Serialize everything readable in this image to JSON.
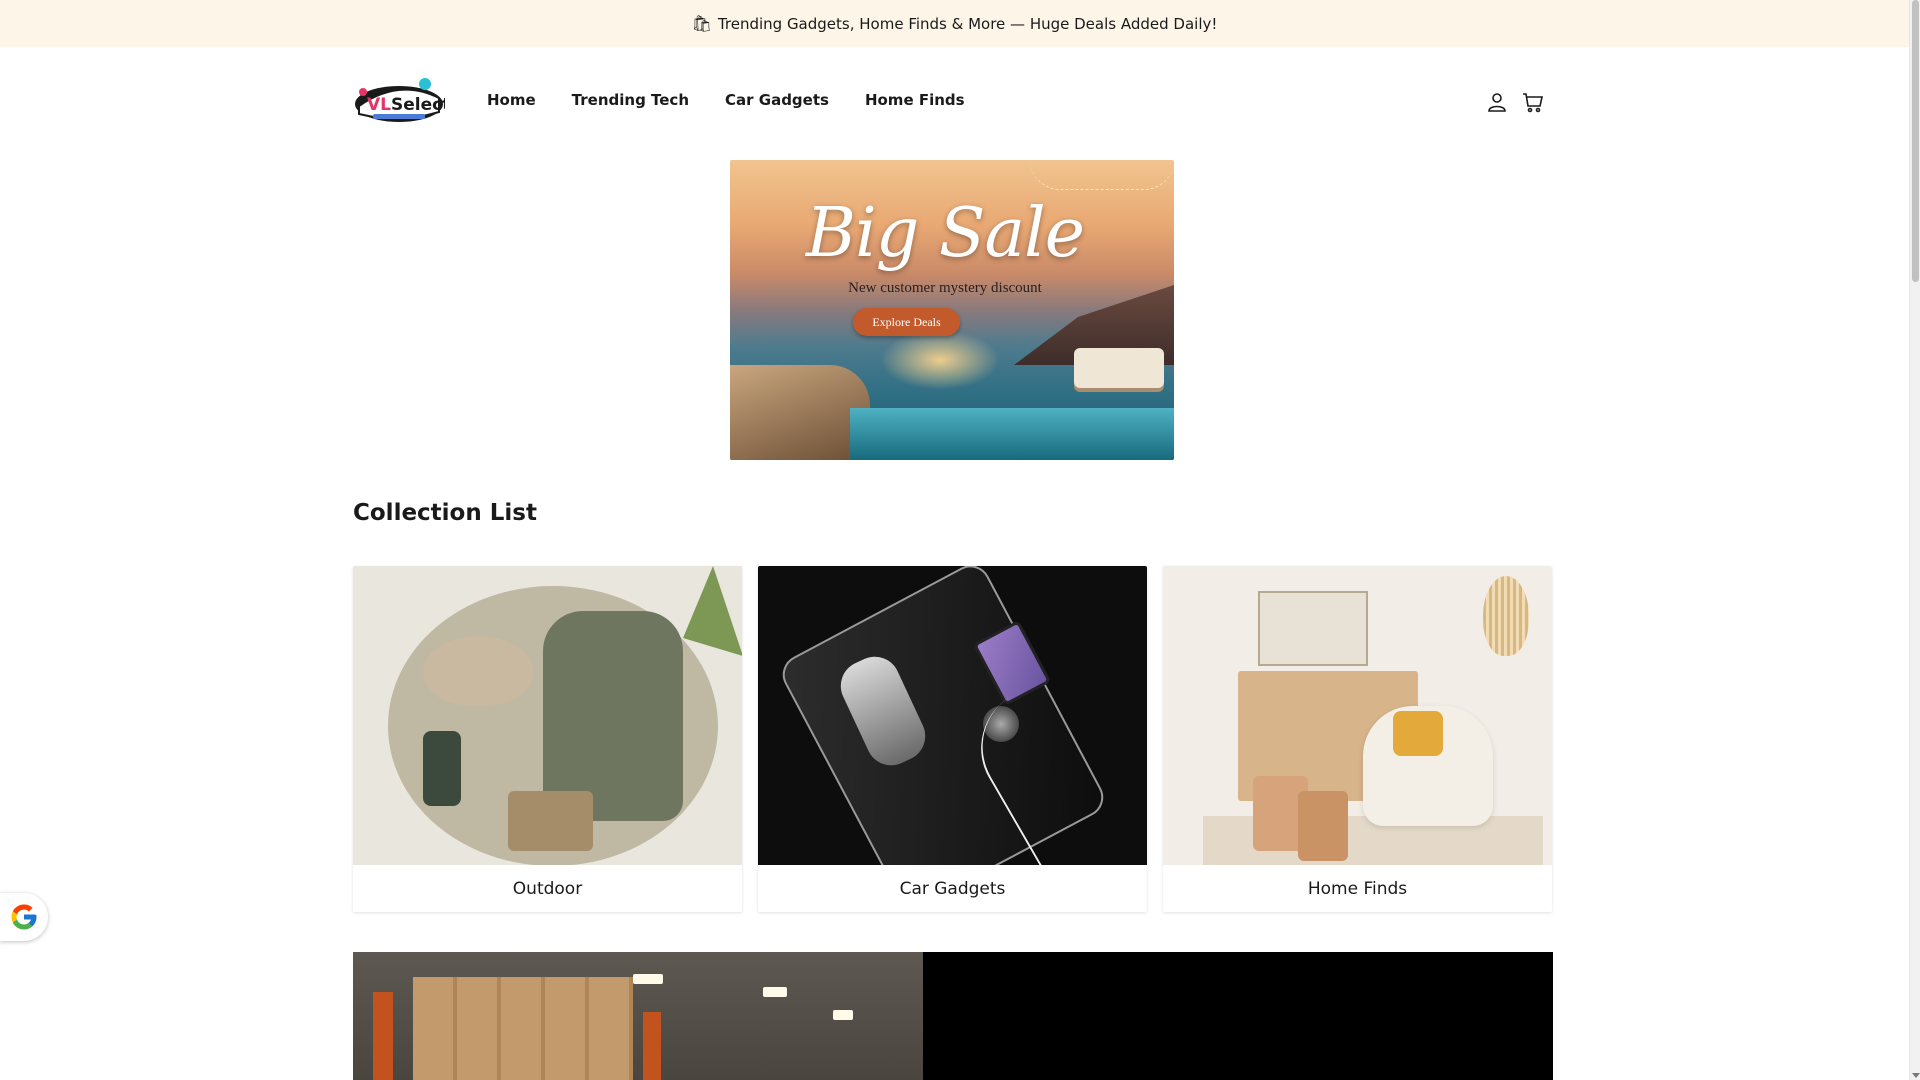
{
  "announcement": {
    "text": "Trending Gadgets, Home Finds & More — Huge Deals Added Daily!",
    "icon": "shopping-bag-icon"
  },
  "header": {
    "logo_alt": "VLSelect",
    "nav": [
      {
        "label": "Home"
      },
      {
        "label": "Trending Tech"
      },
      {
        "label": "Car Gadgets"
      },
      {
        "label": "Home Finds"
      }
    ],
    "icons": [
      "account-icon",
      "cart-icon"
    ]
  },
  "hero": {
    "title": "Big Sale",
    "subtitle": "New customer mystery discount",
    "cta_label": "Explore Deals",
    "cta_color": "#c35a2c"
  },
  "collection_list": {
    "title": "Collection List",
    "items": [
      {
        "label": "Outdoor"
      },
      {
        "label": "Car Gadgets"
      },
      {
        "label": "Home Finds"
      }
    ]
  },
  "colors": {
    "announcement_bg": "#fdf6e8",
    "text": "#1a1a1a"
  }
}
